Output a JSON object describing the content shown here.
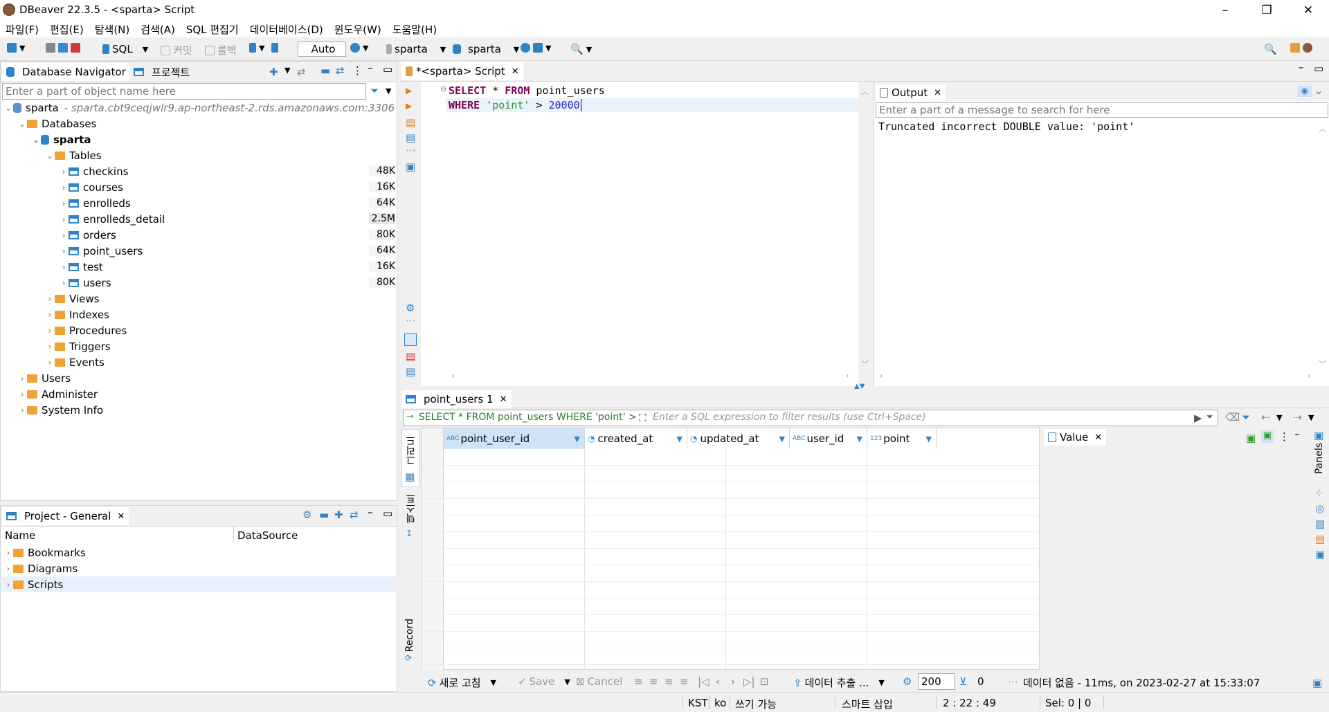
{
  "window": {
    "title": "DBeaver 22.3.5 - <sparta> Script",
    "minimize": "–",
    "maximize": "❐",
    "close": "✕"
  },
  "menu": [
    "파일(F)",
    "편집(E)",
    "탐색(N)",
    "검색(A)",
    "SQL 편집기",
    "데이터베이스(D)",
    "윈도우(W)",
    "도움말(H)"
  ],
  "toolbar": {
    "sql_label": "SQL",
    "commit_label": "커밋",
    "rollback_label": "롤백",
    "mode": "Auto",
    "connection": "sparta",
    "schema": "sparta"
  },
  "navigator": {
    "tab_label": "Database Navigator",
    "project_tab_label": "프로젝트",
    "search_placeholder": "Enter a part of object name here",
    "connection": {
      "name": "sparta",
      "host": "- sparta.cbt9ceqjwlr9.ap-northeast-2.rds.amazonaws.com:3306"
    },
    "databases_label": "Databases",
    "schema_label": "sparta",
    "tables_label": "Tables",
    "tables": [
      {
        "name": "checkins",
        "size": "48K"
      },
      {
        "name": "courses",
        "size": "16K"
      },
      {
        "name": "enrolleds",
        "size": "64K"
      },
      {
        "name": "enrolleds_detail",
        "size": "2.5M"
      },
      {
        "name": "orders",
        "size": "80K"
      },
      {
        "name": "point_users",
        "size": "64K"
      },
      {
        "name": "test",
        "size": "16K"
      },
      {
        "name": "users",
        "size": "80K"
      }
    ],
    "folders": [
      "Views",
      "Indexes",
      "Procedures",
      "Triggers",
      "Events"
    ],
    "top_nodes": [
      "Users",
      "Administer",
      "System Info"
    ]
  },
  "project": {
    "tab_label": "Project - General",
    "col_name": "Name",
    "col_datasource": "DataSource",
    "items": [
      "Bookmarks",
      "Diagrams",
      "Scripts"
    ]
  },
  "editor": {
    "tab_label": "*<sparta> Script",
    "line1": {
      "kw1": "SELECT",
      "rest1": " * ",
      "kw2": "FROM",
      "rest2": " point_users"
    },
    "line2": {
      "kw": "WHERE",
      "sp": " ",
      "str": "'point'",
      "op": " > ",
      "num": "20000"
    }
  },
  "output": {
    "tab_label": "Output",
    "search_placeholder": "Enter a part of a message to search for here",
    "message": "Truncated incorrect DOUBLE value: 'point'"
  },
  "results": {
    "tab_label": "point_users 1",
    "query_label": "SELECT * FROM point_users WHERE 'point' >",
    "filter_placeholder": "Enter a SQL expression to filter results (use Ctrl+Space)",
    "columns": [
      {
        "type": "ABC",
        "name": "point_user_id"
      },
      {
        "type": "",
        "name": "created_at"
      },
      {
        "type": "",
        "name": "updated_at"
      },
      {
        "type": "ABC",
        "name": "user_id"
      },
      {
        "type": "123",
        "name": "point"
      }
    ],
    "side_grid": "그리드",
    "side_text": "텍스트",
    "side_record": "Record",
    "value_tab": "Value",
    "panels_label": "Panels",
    "refresh_label": "새로 고침",
    "save_label": "Save",
    "cancel_label": "Cancel",
    "export_label": "데이터 추출 ...",
    "fetch_size": "200",
    "row_count": "0",
    "status_message": "데이터 없음 - 11ms, on 2023-02-27 at 15:33:07"
  },
  "statusbar": {
    "tz": "KST",
    "locale": "ko",
    "mode": "쓰기 가능",
    "insert": "스마트 삽입",
    "position": "2 : 22 : 49",
    "selection": "Sel: 0 | 0"
  }
}
